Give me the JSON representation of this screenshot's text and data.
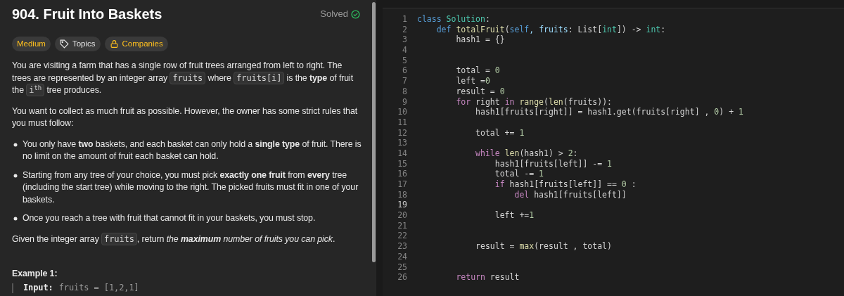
{
  "problem": {
    "title": "904. Fruit Into Baskets",
    "status": "Solved",
    "solved": true,
    "tags": [
      {
        "kind": "difficulty",
        "label": "Medium"
      },
      {
        "kind": "topics",
        "label": "Topics"
      },
      {
        "kind": "companies",
        "label": "Companies"
      }
    ],
    "paragraphs": [
      [
        {
          "kind": "text",
          "text": "You are visiting a farm that has a single row of fruit trees arranged from left to right. The trees are represented by an integer array "
        },
        {
          "kind": "code",
          "text": "fruits"
        },
        {
          "kind": "text",
          "text": " where "
        },
        {
          "kind": "code",
          "text": "fruits[i]"
        },
        {
          "kind": "text",
          "text": " is the **type** of fruit the "
        },
        {
          "kind": "code",
          "text": "i$^{th}$"
        },
        {
          "kind": "text",
          "text": " tree produces."
        }
      ],
      [
        {
          "kind": "text",
          "text": "You want to collect as much fruit as possible. However, the owner has some strict rules that you must follow:"
        }
      ]
    ],
    "rules": [
      "You only have **two** baskets, and each basket can only hold a **single type** of fruit. There is no limit on the amount of fruit each basket can hold.",
      "Starting from any tree of your choice, you must pick **exactly one fruit** from **every** tree (including the start tree) while moving to the right. The picked fruits must fit in one of your baskets.",
      "Once you reach a tree with fruit that cannot fit in your baskets, you must stop."
    ],
    "closing": [
      {
        "kind": "text",
        "text": "Given the integer array "
      },
      {
        "kind": "code",
        "text": "fruits"
      },
      {
        "kind": "text",
        "text": ", return "
      },
      {
        "kind": "emphasis",
        "text": "the **maximum** number of fruits you can pick"
      },
      {
        "kind": "text",
        "text": "."
      }
    ],
    "example_title": "Example 1:",
    "example_input": {
      "label": "Input:",
      "value": "fruits = [1,2,1]"
    }
  },
  "editor": {
    "lines": [
      {
        "number": "1",
        "current": false,
        "tokens": [
          {
            "kind": "keyword",
            "text": "class"
          },
          {
            "kind": "type",
            "text": " Solution"
          },
          {
            "kind": "plain",
            "text": ":"
          }
        ]
      },
      {
        "number": "2",
        "current": false,
        "tokens": [
          {
            "kind": "keyword",
            "text": "    def"
          },
          {
            "kind": "function",
            "text": " totalFruit"
          },
          {
            "kind": "plain",
            "text": "("
          },
          {
            "kind": "keyword",
            "text": "self"
          },
          {
            "kind": "variable",
            "text": ", fruits"
          },
          {
            "kind": "plain",
            "text": ": List["
          },
          {
            "kind": "type",
            "text": "int"
          },
          {
            "kind": "plain",
            "text": "]) ->"
          },
          {
            "kind": "type",
            "text": " int"
          },
          {
            "kind": "plain",
            "text": ":"
          }
        ]
      },
      {
        "number": "3",
        "current": false,
        "tokens": [
          {
            "kind": "plain",
            "text": "        hash1 = {}"
          }
        ]
      },
      {
        "number": "4",
        "current": false
      },
      {
        "number": "5",
        "current": false
      },
      {
        "number": "6",
        "current": false,
        "tokens": [
          {
            "kind": "plain",
            "text": "        total ="
          },
          {
            "kind": "number",
            "text": " 0"
          }
        ]
      },
      {
        "number": "7",
        "current": false,
        "tokens": [
          {
            "kind": "plain",
            "text": "        left ="
          },
          {
            "kind": "number",
            "text": "0"
          }
        ]
      },
      {
        "number": "8",
        "current": false,
        "tokens": [
          {
            "kind": "plain",
            "text": "        result ="
          },
          {
            "kind": "number",
            "text": " 0"
          }
        ]
      },
      {
        "number": "9",
        "current": false,
        "tokens": [
          {
            "kind": "control",
            "text": "        for"
          },
          {
            "kind": "plain",
            "text": " right"
          },
          {
            "kind": "control",
            "text": " in"
          },
          {
            "kind": "function",
            "text": " range"
          },
          {
            "kind": "plain",
            "text": "("
          },
          {
            "kind": "function",
            "text": "len"
          },
          {
            "kind": "plain",
            "text": "(fruits)):"
          }
        ]
      },
      {
        "number": "10",
        "current": false,
        "tokens": [
          {
            "kind": "plain",
            "text": "            hash1[fruits[right]] = hash1.get(fruits[right] ,"
          },
          {
            "kind": "number",
            "text": " 0"
          },
          {
            "kind": "plain",
            "text": ") +"
          },
          {
            "kind": "number",
            "text": " 1"
          }
        ]
      },
      {
        "number": "11",
        "current": false
      },
      {
        "number": "12",
        "current": false,
        "tokens": [
          {
            "kind": "plain",
            "text": "            total +="
          },
          {
            "kind": "number",
            "text": " 1"
          }
        ]
      },
      {
        "number": "13",
        "current": false
      },
      {
        "number": "14",
        "current": false,
        "tokens": [
          {
            "kind": "control",
            "text": "            while"
          },
          {
            "kind": "function",
            "text": " len"
          },
          {
            "kind": "plain",
            "text": "(hash1) >"
          },
          {
            "kind": "number",
            "text": " 2"
          },
          {
            "kind": "plain",
            "text": ":"
          }
        ]
      },
      {
        "number": "15",
        "current": false,
        "tokens": [
          {
            "kind": "plain",
            "text": "                hash1[fruits[left]] -="
          },
          {
            "kind": "number",
            "text": " 1"
          }
        ]
      },
      {
        "number": "16",
        "current": false,
        "tokens": [
          {
            "kind": "plain",
            "text": "                total -="
          },
          {
            "kind": "number",
            "text": " 1"
          }
        ]
      },
      {
        "number": "17",
        "current": false,
        "tokens": [
          {
            "kind": "control",
            "text": "                if"
          },
          {
            "kind": "plain",
            "text": " hash1[fruits[left]] =="
          },
          {
            "kind": "number",
            "text": " 0"
          },
          {
            "kind": "plain",
            "text": " :"
          }
        ]
      },
      {
        "number": "18",
        "current": false,
        "tokens": [
          {
            "kind": "control",
            "text": "                    del"
          },
          {
            "kind": "plain",
            "text": " hash1[fruits[left]]"
          }
        ]
      },
      {
        "number": "19",
        "current": true
      },
      {
        "number": "20",
        "current": false,
        "tokens": [
          {
            "kind": "plain",
            "text": "                left +="
          },
          {
            "kind": "number",
            "text": "1"
          }
        ]
      },
      {
        "number": "21",
        "current": false
      },
      {
        "number": "22",
        "current": false
      },
      {
        "number": "23",
        "current": false,
        "tokens": [
          {
            "kind": "plain",
            "text": "            result ="
          },
          {
            "kind": "function",
            "text": " max"
          },
          {
            "kind": "plain",
            "text": "(result , total)"
          }
        ]
      },
      {
        "number": "24",
        "current": false
      },
      {
        "number": "25",
        "current": false
      },
      {
        "number": "26",
        "current": false,
        "tokens": [
          {
            "kind": "control",
            "text": "        return"
          },
          {
            "kind": "plain",
            "text": " result"
          }
        ]
      }
    ]
  }
}
